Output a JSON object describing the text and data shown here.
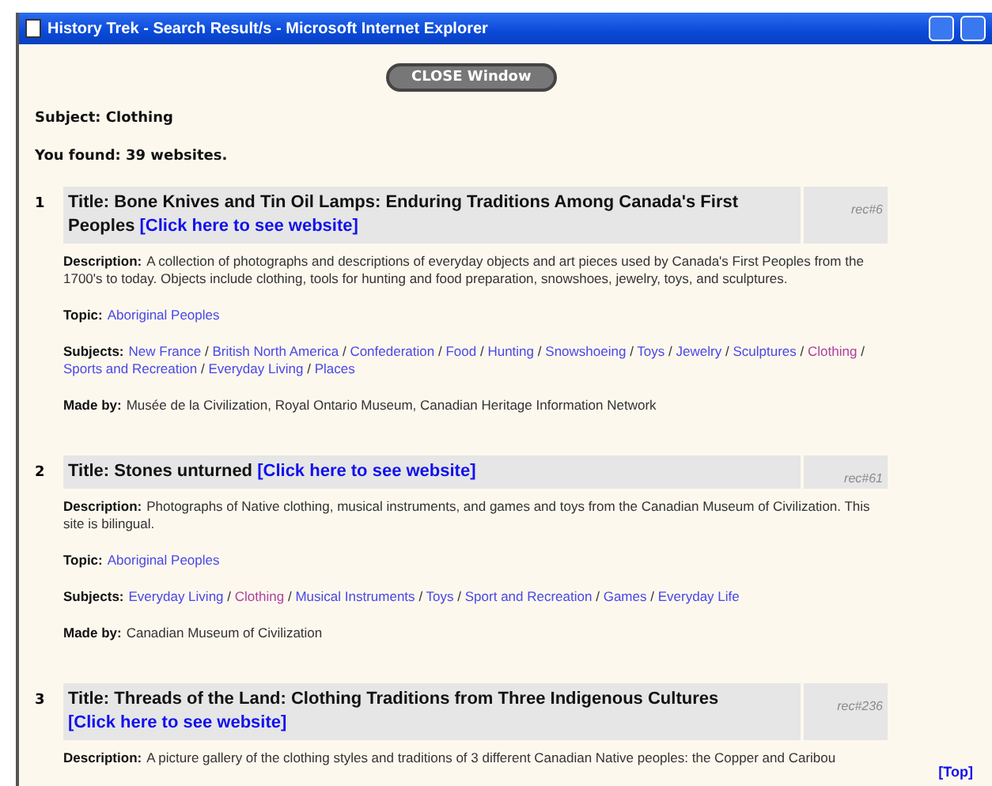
{
  "window": {
    "title": "History Trek - Search Result/s - Microsoft Internet Explorer"
  },
  "close_button": "CLOSE Window",
  "subject": {
    "label": "Subject:",
    "value": "Clothing"
  },
  "found": "You found: 39 websites.",
  "results": [
    {
      "number": "1",
      "title_label": "Title:",
      "title": "Bone Knives and Tin Oil Lamps: Enduring Traditions Among Canada's First Peoples",
      "link": "[Click here to see website]",
      "rec": "rec#6",
      "description_label": "Description:",
      "description": "A collection of photographs and descriptions of everyday objects and art pieces used by Canada's First Peoples from the 1700's to today. Objects include clothing, tools for hunting and food preparation, snowshoes, jewelry, toys, and sculptures.",
      "topic_label": "Topic:",
      "topic": "Aboriginal Peoples",
      "subjects_label": "Subjects:",
      "separator": "/",
      "subjects": [
        {
          "label": "New France",
          "current": false
        },
        {
          "label": "British North America",
          "current": false
        },
        {
          "label": "Confederation",
          "current": false
        },
        {
          "label": "Food",
          "current": false
        },
        {
          "label": "Hunting",
          "current": false
        },
        {
          "label": "Snowshoeing",
          "current": false
        },
        {
          "label": "Toys",
          "current": false
        },
        {
          "label": "Jewelry",
          "current": false
        },
        {
          "label": "Sculptures",
          "current": false
        },
        {
          "label": "Clothing",
          "current": true
        },
        {
          "label": "Sports and Recreation",
          "current": false
        },
        {
          "label": "Everyday Living",
          "current": false
        },
        {
          "label": "Places",
          "current": false
        }
      ],
      "made_by_label": "Made by:",
      "made_by": "Musée de la Civilization, Royal Ontario Museum, Canadian Heritage Information Network"
    },
    {
      "number": "2",
      "title_label": "Title:",
      "title": "Stones unturned",
      "link": "[Click here to see website]",
      "rec": "rec#61",
      "description_label": "Description:",
      "description": "Photographs of Native clothing, musical instruments, and games and toys from the Canadian Museum of Civilization. This site is bilingual.",
      "topic_label": "Topic:",
      "topic": "Aboriginal Peoples",
      "subjects_label": "Subjects:",
      "separator": "/",
      "subjects": [
        {
          "label": "Everyday Living",
          "current": false
        },
        {
          "label": "Clothing",
          "current": true
        },
        {
          "label": "Musical Instruments",
          "current": false
        },
        {
          "label": "Toys",
          "current": false
        },
        {
          "label": "Sport and Recreation",
          "current": false
        },
        {
          "label": "Games",
          "current": false
        },
        {
          "label": "Everyday Life",
          "current": false
        }
      ],
      "made_by_label": "Made by:",
      "made_by": "Canadian Museum of Civilization"
    },
    {
      "number": "3",
      "title_label": "Title:",
      "title": "Threads of the Land: Clothing Traditions from Three Indigenous Cultures",
      "link": "[Click here to see website]",
      "rec": "rec#236",
      "description_label": "Description:",
      "description": "A picture gallery of the clothing styles and traditions of 3 different Canadian Native peoples: the Copper and Caribou"
    }
  ],
  "top_link": "[Top]"
}
